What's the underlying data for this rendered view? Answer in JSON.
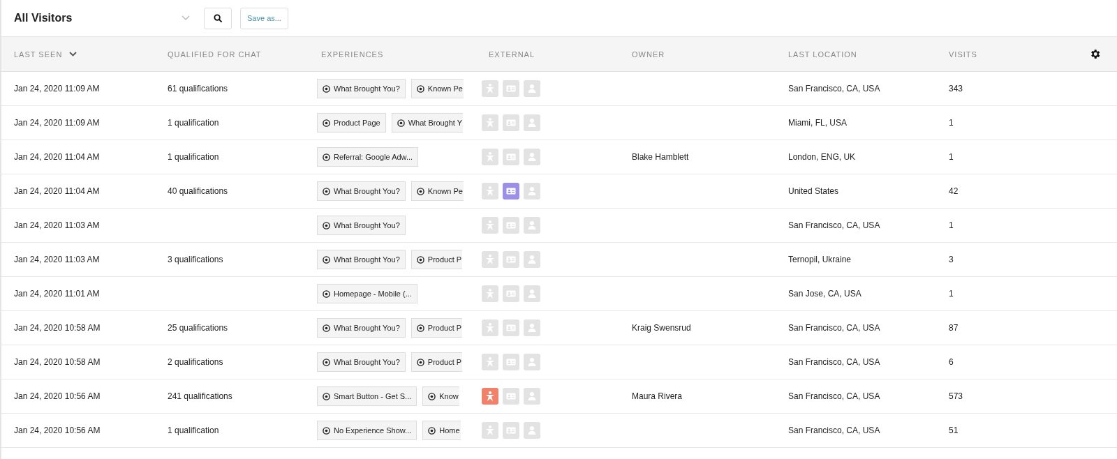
{
  "toolbar": {
    "view_title": "All Visitors",
    "save_button": "Save as..."
  },
  "table": {
    "columns": [
      {
        "label": "LAST SEEN",
        "sorted": true
      },
      {
        "label": "QUALIFIED FOR CHAT",
        "sorted": false
      },
      {
        "label": "EXPERIENCES",
        "sorted": false
      },
      {
        "label": "EXTERNAL",
        "sorted": false
      },
      {
        "label": "OWNER",
        "sorted": false
      },
      {
        "label": "LAST LOCATION",
        "sorted": false
      },
      {
        "label": "VISITS",
        "sorted": false
      }
    ],
    "rows": [
      {
        "last_seen": "Jan 24, 2020 11:09 AM",
        "qualified": "61 qualifications",
        "experiences": [
          "What Brought You?",
          "Known Pe"
        ],
        "external": {
          "star": false,
          "card": false,
          "person": false
        },
        "owner": "",
        "location": "San Francisco, CA, USA",
        "visits": "343"
      },
      {
        "last_seen": "Jan 24, 2020 11:09 AM",
        "qualified": "1 qualification",
        "experiences": [
          "Product Page",
          "What Brought Y"
        ],
        "external": {
          "star": false,
          "card": false,
          "person": false
        },
        "owner": "",
        "location": "Miami, FL, USA",
        "visits": "1"
      },
      {
        "last_seen": "Jan 24, 2020 11:04 AM",
        "qualified": "1 qualification",
        "experiences": [
          "Referral: Google Adw..."
        ],
        "external": {
          "star": false,
          "card": false,
          "person": false
        },
        "owner": "Blake Hamblett",
        "location": "London, ENG, UK",
        "visits": "1"
      },
      {
        "last_seen": "Jan 24, 2020 11:04 AM",
        "qualified": "40 qualifications",
        "experiences": [
          "What Brought You?",
          "Known Pe"
        ],
        "external": {
          "star": false,
          "card": true,
          "person": false
        },
        "owner": "",
        "location": "United States",
        "visits": "42"
      },
      {
        "last_seen": "Jan 24, 2020 11:03 AM",
        "qualified": "",
        "experiences": [
          "What Brought You?"
        ],
        "external": {
          "star": false,
          "card": false,
          "person": false
        },
        "owner": "",
        "location": "San Francisco, CA, USA",
        "visits": "1"
      },
      {
        "last_seen": "Jan 24, 2020 11:03 AM",
        "qualified": "3 qualifications",
        "experiences": [
          "What Brought You?",
          "Product P"
        ],
        "external": {
          "star": false,
          "card": false,
          "person": false
        },
        "owner": "",
        "location": "Ternopil, Ukraine",
        "visits": "3"
      },
      {
        "last_seen": "Jan 24, 2020 11:01 AM",
        "qualified": "",
        "experiences": [
          "Homepage - Mobile (..."
        ],
        "external": {
          "star": false,
          "card": false,
          "person": false
        },
        "owner": "",
        "location": "San Jose, CA, USA",
        "visits": "1"
      },
      {
        "last_seen": "Jan 24, 2020 10:58 AM",
        "qualified": "25 qualifications",
        "experiences": [
          "What Brought You?",
          "Product P"
        ],
        "external": {
          "star": false,
          "card": false,
          "person": false
        },
        "owner": "Kraig Swensrud",
        "location": "San Francisco, CA, USA",
        "visits": "87"
      },
      {
        "last_seen": "Jan 24, 2020 10:58 AM",
        "qualified": "2 qualifications",
        "experiences": [
          "What Brought You?",
          "Product P"
        ],
        "external": {
          "star": false,
          "card": false,
          "person": false
        },
        "owner": "",
        "location": "San Francisco, CA, USA",
        "visits": "6"
      },
      {
        "last_seen": "Jan 24, 2020 10:56 AM",
        "qualified": "241 qualifications",
        "experiences": [
          "Smart Button - Get S...",
          "Know"
        ],
        "external": {
          "star": true,
          "card": false,
          "person": false
        },
        "owner": "Maura Rivera",
        "location": "San Francisco, CA, USA",
        "visits": "573"
      },
      {
        "last_seen": "Jan 24, 2020 10:56 AM",
        "qualified": "1 qualification",
        "experiences": [
          "No Experience Show...",
          "Home"
        ],
        "external": {
          "star": false,
          "card": false,
          "person": false
        },
        "owner": "",
        "location": "San Francisco, CA, USA",
        "visits": "51"
      }
    ]
  }
}
